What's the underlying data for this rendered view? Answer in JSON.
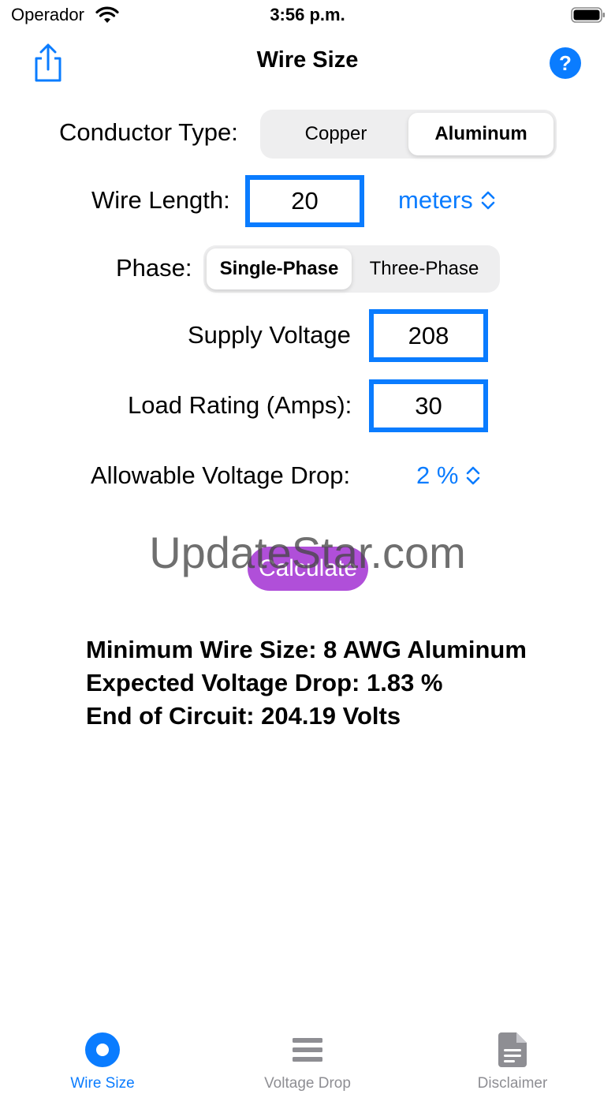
{
  "status_bar": {
    "carrier": "Operador",
    "time": "3:56 p.m."
  },
  "nav": {
    "title": "Wire Size",
    "share_icon": "share-icon",
    "help_icon": "help-icon",
    "help_glyph": "?"
  },
  "conductor": {
    "label": "Conductor Type:",
    "options": [
      "Copper",
      "Aluminum"
    ],
    "selected": "Aluminum"
  },
  "wire_length": {
    "label": "Wire Length:",
    "value": "20",
    "unit": "meters"
  },
  "phase": {
    "label": "Phase:",
    "options": [
      "Single-Phase",
      "Three-Phase"
    ],
    "selected": "Single-Phase"
  },
  "supply_voltage": {
    "label": "Supply Voltage",
    "value": "208"
  },
  "load_rating": {
    "label": "Load Rating (Amps):",
    "value": "30"
  },
  "voltage_drop": {
    "label": "Allowable Voltage Drop:",
    "value": "2 %"
  },
  "calculate_label": "Calculate",
  "watermark": "UpdateStar.com",
  "results": {
    "min_wire_size": "Minimum Wire Size: 8 AWG Aluminum",
    "expected_drop": "Expected Voltage Drop: 1.83 %",
    "end_of_circuit": "End of Circuit: 204.19 Volts"
  },
  "tabs": [
    {
      "label": "Wire Size",
      "icon": "circle-dot-icon",
      "active": true
    },
    {
      "label": "Voltage Drop",
      "icon": "bars-icon",
      "active": false
    },
    {
      "label": "Disclaimer",
      "icon": "document-icon",
      "active": false
    }
  ],
  "colors": {
    "accent": "#0a7cff",
    "calculate": "#b04fd9",
    "inactive_tab": "#8e8e93"
  }
}
